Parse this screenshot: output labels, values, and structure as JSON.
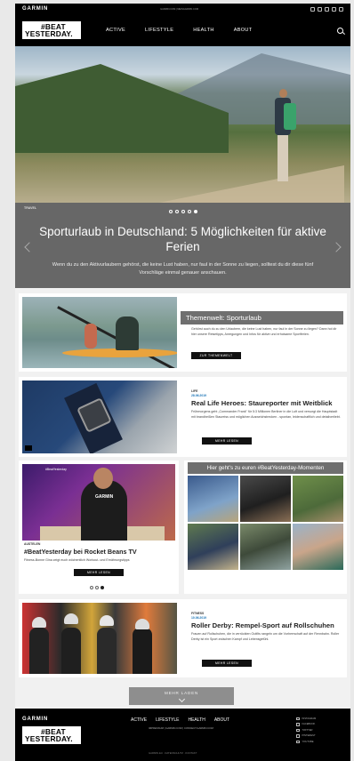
{
  "header": {
    "brand": "GARMIN",
    "toplinks": "GARMIN.COM | MEINGARMIN.COM",
    "logo_line1": "#BEAT",
    "logo_line2": "YESTERDAY.",
    "nav": [
      "ACTIVE",
      "LIFESTYLE",
      "HEALTH",
      "ABOUT"
    ],
    "social_icons": [
      "instagram-icon",
      "facebook-icon",
      "twitter-icon",
      "pinterest-icon",
      "youtube-icon"
    ]
  },
  "hero": {
    "tag": "TRAVEL",
    "title": "Sporturlaub in Deutschland: 5 Möglichkeiten für aktive Ferien",
    "text": "Wenn du zu den Aktivurlaubern gehörst, die keine Lust haben, nur faul in der Sonne zu liegen, solltest du dir diese fünf Vorschläge einmal genauer anschauen.",
    "slides_total": 5,
    "slide_active": 5
  },
  "cards": {
    "topic": {
      "label": "Themenwelt: Sporturlaub",
      "text": "Gehörst auch du zu den Urlaubern, die keine Lust haben, nur faul in der Sonne zu liegen? Dann hol dir hier unsere Reisetipps, Anregungen und Infos für aktive und erholsame Sportferien.",
      "button": "ZUR THEMENWELT"
    },
    "heroes": {
      "kicker": "LIFE",
      "date": "28.06.2019",
      "title": "Real Life Heroes: Staureporter mit Weitblick",
      "text": "Frühmorgens geht „Commander Frank\" für 5:3 Millionen Berliner in die Luft und versorgt die Hauptstadt mit brandheißen Staureiss und möglichen Ausweichstrecken - spontan, leidenschaftlich und detailverliebt.",
      "button": "MEHR LESEN"
    },
    "tv": {
      "kicker": "AUSTELEN",
      "title": "#BeatYesterday bei Rocket Beans TV",
      "text": "Fitness-Bonne Gina zeigt euch wöchentlich Workout- und Ernährungstipps",
      "button": "MEHR LESEN",
      "image_caption": "#BeatYesterday",
      "dots_total": 3,
      "dot_active": 3
    },
    "moments": {
      "label": "Hier geht's zu euren #BeatYesterday-Momenten"
    },
    "derby": {
      "kicker": "FITNESS",
      "date": "10.06.2019",
      "title": "Roller Derby: Rempel-Sport auf Rollschuhen",
      "text": "Frauen auf Rollschuhen, die in verrückten Outfits rangeln um die Vorherrschaft auf der Rennbahn. Roller Derby ist ein Sport zwischen Kampf und Lebensgefühl.",
      "button": "MEHR LESEN"
    }
  },
  "more_button": "MEHR LADEN",
  "footer": {
    "brand": "GARMIN",
    "logo_line1": "#BEAT",
    "logo_line2": "YESTERDAY.",
    "nav": [
      "ACTIVE",
      "LIFESTYLE",
      "HEALTH",
      "ABOUT"
    ],
    "sublinks": "IMPRESSUM | GARMIN.COM | CONNECT.GARMIN.COM",
    "copyright": "GARMIN.EU · DATENSCHUTZ · KONTAKT",
    "social": [
      "INSTAGRAM",
      "FACEBOOK",
      "TWITTER",
      "PINTEREST",
      "YOUTUBE"
    ]
  },
  "colors": {
    "header_bg": "#000000",
    "hero_panel_bg": "#676767",
    "label_bg": "#6f6f6f",
    "button_bg": "#111111",
    "kicker_blue": "#1a73b5",
    "page_bg": "#f1f1f1"
  }
}
